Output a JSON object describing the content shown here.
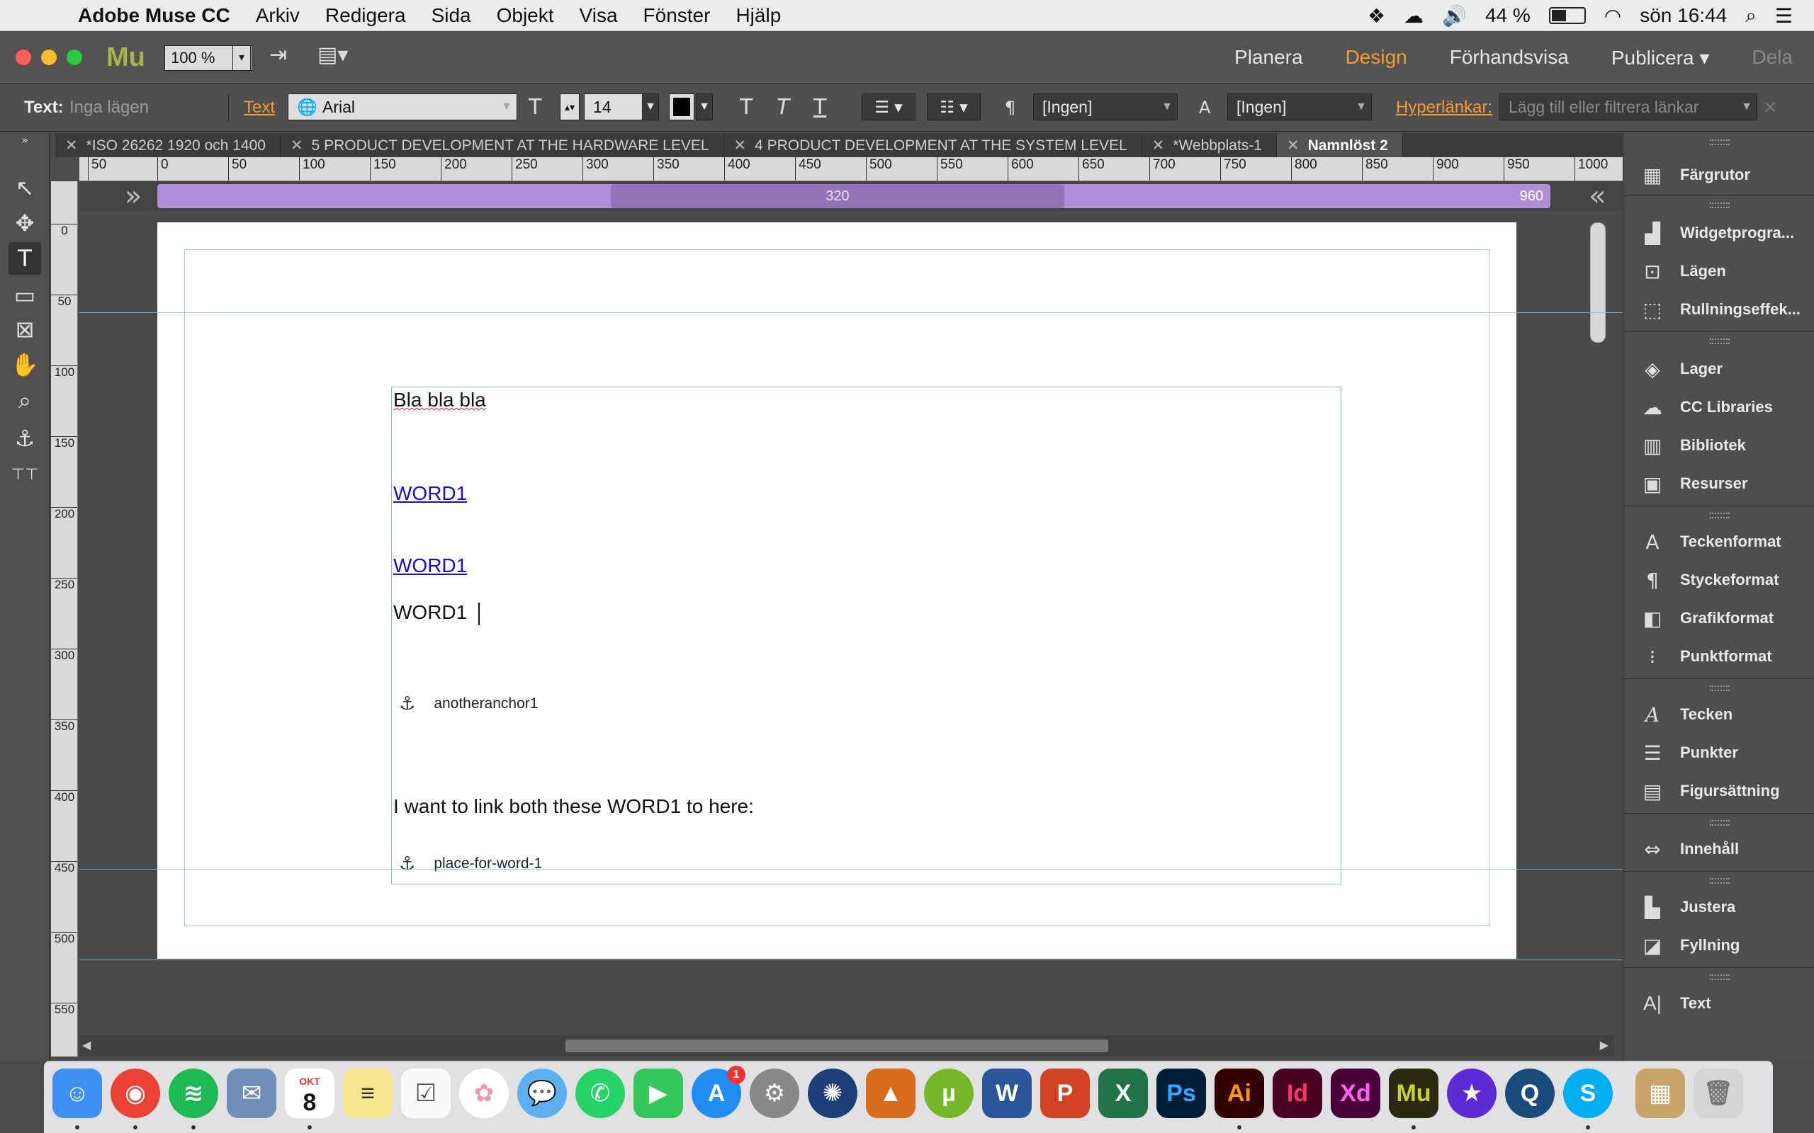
{
  "menubar": {
    "apple": "",
    "app_name": "Adobe Muse CC",
    "menus": [
      "Arkiv",
      "Redigera",
      "Sida",
      "Objekt",
      "Visa",
      "Fönster",
      "Hjälp"
    ],
    "battery": "44 %",
    "clock": "sön 16:44"
  },
  "appbar": {
    "logo": "Mu",
    "zoom": "100 %",
    "modes": [
      {
        "label": "Planera"
      },
      {
        "label": "Design"
      },
      {
        "label": "Förhandsvisa"
      },
      {
        "label": "Publicera ▾"
      },
      {
        "label": "Dela"
      }
    ]
  },
  "controlbar": {
    "text_label": "Text:",
    "states": "Inga lägen",
    "text_link": "Text",
    "font": "Arial",
    "size": "14",
    "paragraph_style": "[Ingen]",
    "character_style": "[Ingen]",
    "hyperlinks_label": "Hyperlänkar:",
    "hyperlink_placeholder": "Lägg till eller filtrera länkar"
  },
  "tabs": [
    {
      "label": "*ISO 26262 1920 och 1400"
    },
    {
      "label": "5 PRODUCT DEVELOPMENT AT THE HARDWARE LEVEL"
    },
    {
      "label": "4 PRODUCT DEVELOPMENT AT THE SYSTEM LEVEL"
    },
    {
      "label": "*Webbplats-1"
    },
    {
      "label": "Namnlöst 2"
    }
  ],
  "hruler": [
    "50",
    "0",
    "50",
    "100",
    "150",
    "200",
    "250",
    "300",
    "350",
    "400",
    "450",
    "500",
    "550",
    "600",
    "650",
    "700",
    "750",
    "800",
    "850",
    "900",
    "950",
    "1000"
  ],
  "vruler": [
    "0",
    "50",
    "100",
    "150",
    "200",
    "250",
    "300",
    "350",
    "400",
    "450",
    "500",
    "550"
  ],
  "breakpoints": {
    "mid": "320",
    "end": "960"
  },
  "content": {
    "line1": "Bla bla bla",
    "link1": "WORD1 ",
    "link2": "WORD1 ",
    "plain": "WORD1 ",
    "anchor1": "anotheranchor1",
    "instruction": "I want to link both these WORD1 to here:",
    "anchor2": "place-for-word-1"
  },
  "panels": [
    {
      "label": "Färgrutor"
    },
    {
      "label": "Widgetprogra..."
    },
    {
      "label": "Lägen"
    },
    {
      "label": "Rullningseffek..."
    },
    {
      "label": "Lager"
    },
    {
      "label": "CC Libraries"
    },
    {
      "label": "Bibliotek"
    },
    {
      "label": "Resurser"
    },
    {
      "label": "Teckenformat"
    },
    {
      "label": "Styckeformat"
    },
    {
      "label": "Grafikformat"
    },
    {
      "label": "Punktformat"
    },
    {
      "label": "Tecken"
    },
    {
      "label": "Punkter"
    },
    {
      "label": "Figursättning"
    },
    {
      "label": "Innehåll"
    },
    {
      "label": "Justera"
    },
    {
      "label": "Fyllning"
    },
    {
      "label": "Text"
    }
  ],
  "dock": {
    "calendar_month": "OKT",
    "calendar_day": "8",
    "appstore_badge": "1",
    "apps": [
      "W",
      "P",
      "X",
      "Ps",
      "Ai",
      "Id",
      "Xd",
      "Mu"
    ]
  },
  "colors": {
    "accent": "#f39a32",
    "breakpoint": "#b08fd8",
    "link": "#1a0dcc",
    "guide": "#8fb8e0"
  }
}
